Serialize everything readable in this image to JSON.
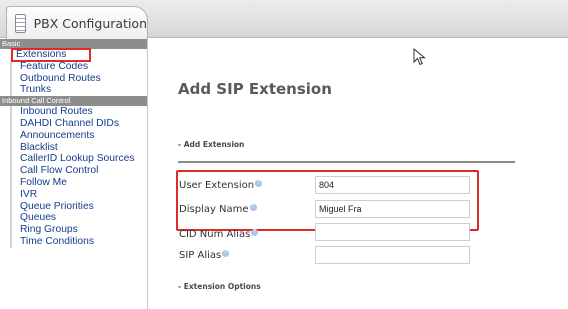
{
  "tab": {
    "label": "PBX Configuration",
    "icon": "document-list-icon"
  },
  "sidebar": {
    "sections": [
      {
        "title": "Basic",
        "items": [
          "Extensions",
          "Feature Codes",
          "Outbound Routes",
          "Trunks"
        ]
      },
      {
        "title": "Inbound Call Control",
        "items": [
          "Inbound Routes",
          "DAHDI Channel DIDs",
          "Announcements",
          "Blacklist",
          "CallerID Lookup Sources",
          "Call Flow Control",
          "Follow Me",
          "IVR",
          "Queue Priorities",
          "Queues",
          "Ring Groups",
          "Time Conditions"
        ]
      }
    ],
    "active_item": "Extensions"
  },
  "main": {
    "title": "Add SIP Extension",
    "section_add": "- Add Extension",
    "section_options": "- Extension Options",
    "fields": [
      {
        "label": "User Extension",
        "value": "804"
      },
      {
        "label": "Display Name",
        "value": "Miguel Fra"
      },
      {
        "label": "CID Num Alias",
        "value": ""
      },
      {
        "label": "SIP Alias",
        "value": ""
      }
    ]
  },
  "colors": {
    "highlight": "#dd2b2b",
    "link": "#173d8c",
    "section_bar": "#8d8d8d"
  }
}
